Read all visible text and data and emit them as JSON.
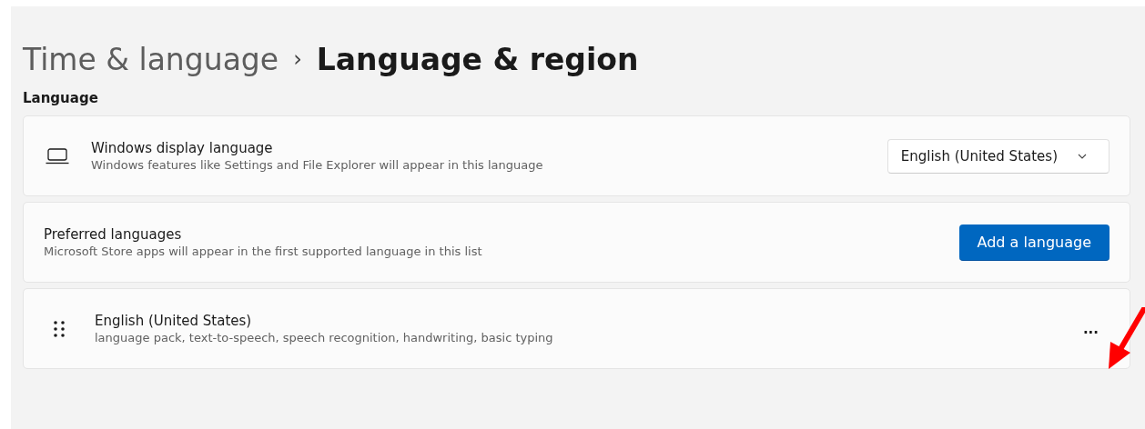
{
  "breadcrumb": {
    "parent": "Time & language",
    "separator": "›",
    "current": "Language & region"
  },
  "section_title": "Language",
  "cards": [
    {
      "kind": "dropdown",
      "title": "Windows display language",
      "description": "Windows features like Settings and File Explorer will appear in this language",
      "value": "English (United States)"
    },
    {
      "kind": "button",
      "title": "Preferred languages",
      "description": "Microsoft Store apps will appear in the first supported language in this list",
      "button": "Add a language"
    },
    {
      "kind": "language",
      "title": "English (United States)",
      "description": "language pack, text-to-speech, speech recognition, handwriting, basic typing",
      "more": "..."
    }
  ]
}
